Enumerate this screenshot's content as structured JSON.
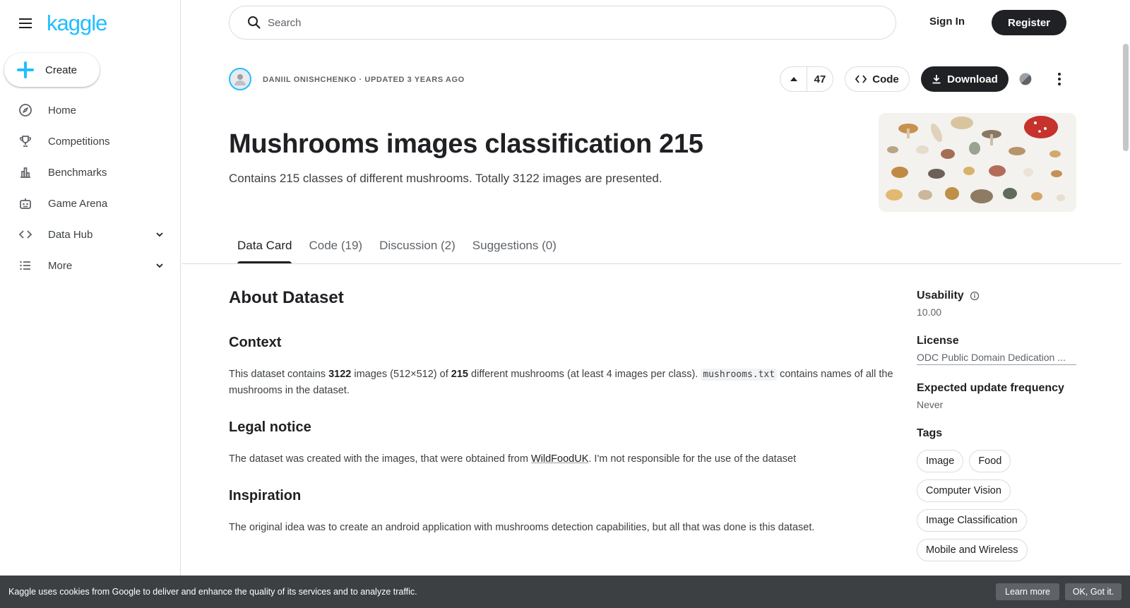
{
  "app": {
    "logo": "kaggle"
  },
  "sidebar": {
    "create_label": "Create",
    "items": [
      {
        "label": "Home",
        "icon": "compass-icon"
      },
      {
        "label": "Competitions",
        "icon": "trophy-icon"
      },
      {
        "label": "Benchmarks",
        "icon": "bar-chart-icon"
      },
      {
        "label": "Game Arena",
        "icon": "robot-icon"
      },
      {
        "label": "Data Hub",
        "icon": "code-brackets-icon"
      },
      {
        "label": "More",
        "icon": "list-icon"
      }
    ]
  },
  "topbar": {
    "search_placeholder": "Search",
    "signin_label": "Sign In",
    "register_label": "Register"
  },
  "dataset": {
    "byline": "DANIIL ONISHCHENKO · UPDATED 3 YEARS AGO",
    "vote_count": "47",
    "code_label": "Code",
    "download_label": "Download",
    "title": "Mushrooms images classification 215",
    "subtitle": "Contains 215 classes of different mushrooms. Totally 3122 images are presented."
  },
  "tabs": [
    {
      "label": "Data Card",
      "active": true
    },
    {
      "label": "Code (19)"
    },
    {
      "label": "Discussion (2)"
    },
    {
      "label": "Suggestions (0)"
    }
  ],
  "content": {
    "about_heading": "About Dataset",
    "context_heading": "Context",
    "context_p1_a": "This dataset contains ",
    "context_p1_b": "3122",
    "context_p1_c": " images (512×512) of ",
    "context_p1_d": "215",
    "context_p1_e": " different mushrooms (at least 4 images per class). ",
    "context_code": "mushrooms.txt",
    "context_p1_f": " contains names of all the mushrooms in the dataset.",
    "legal_heading": "Legal notice",
    "legal_p_a": "The dataset was created with the images, that were obtained from ",
    "legal_link": "WildFoodUK",
    "legal_p_b": ". I'm not responsible for the use of the dataset",
    "inspiration_heading": "Inspiration",
    "inspiration_p": "The original idea was to create an android application with mushrooms detection capabilities, but all that was done is this dataset."
  },
  "meta": {
    "usability_label": "Usability",
    "usability_value": "10.00",
    "license_label": "License",
    "license_value": "ODC Public Domain Dedication ...",
    "frequency_label": "Expected update frequency",
    "frequency_value": "Never",
    "tags_label": "Tags",
    "tags": [
      "Image",
      "Food",
      "Computer Vision",
      "Image Classification",
      "Mobile and Wireless"
    ]
  },
  "cookie": {
    "text": "Kaggle uses cookies from Google to deliver and enhance the quality of its services and to analyze traffic.",
    "learn_more": "Learn more",
    "ok": "OK, Got it."
  },
  "colors": {
    "brand": "#20beff",
    "dark": "#202124",
    "cookie_bg": "#3c4043"
  }
}
